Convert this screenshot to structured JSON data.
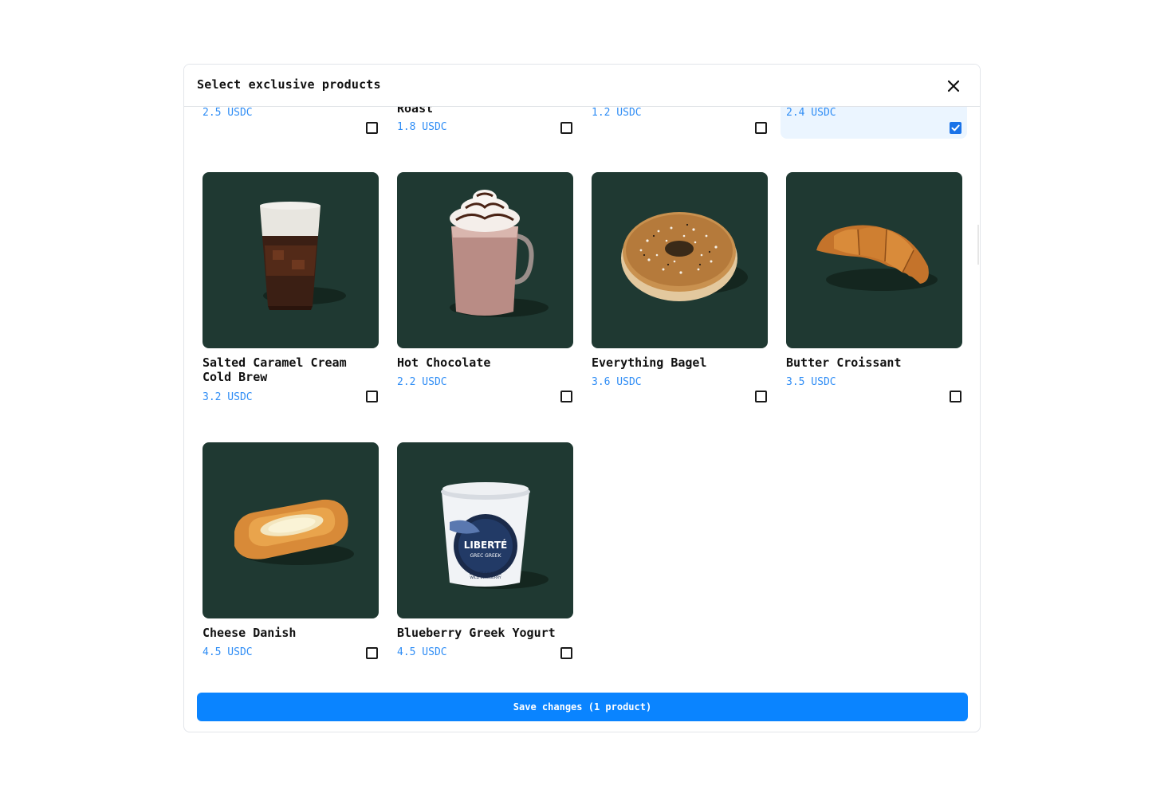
{
  "modal": {
    "title": "Select exclusive products",
    "close_icon": "close-icon",
    "save_label": "Save changes (1 product)"
  },
  "top_row": [
    {
      "name": "",
      "price": "2.5 USDC",
      "checked": false
    },
    {
      "name": "Roast",
      "price": "1.8 USDC",
      "checked": false
    },
    {
      "name": "",
      "price": "1.2 USDC",
      "checked": false
    },
    {
      "name": "",
      "price": "2.4 USDC",
      "checked": true
    }
  ],
  "products": [
    {
      "name": "Salted Caramel Cream Cold Brew",
      "price": "3.2 USDC",
      "checked": false,
      "image": "cold-brew-image"
    },
    {
      "name": "Hot Chocolate",
      "price": "2.2 USDC",
      "checked": false,
      "image": "hot-chocolate-image"
    },
    {
      "name": "Everything Bagel",
      "price": "3.6 USDC",
      "checked": false,
      "image": "bagel-image"
    },
    {
      "name": "Butter Croissant",
      "price": "3.5 USDC",
      "checked": false,
      "image": "croissant-image"
    },
    {
      "name": "Cheese Danish",
      "price": "4.5 USDC",
      "checked": false,
      "image": "danish-image"
    },
    {
      "name": "Blueberry Greek Yogurt",
      "price": "4.5 USDC",
      "checked": false,
      "image": "yogurt-image",
      "label_lines": [
        "LIBERTÉ",
        "GREC GREEK",
        "BLEUET SAUVAGE",
        "WILD BLUEBERRY"
      ]
    }
  ],
  "colors": {
    "image_bg": "#1f3932",
    "price": "#2f8df5",
    "accent": "#0a84ff",
    "selected_bg": "#ebf5ff"
  }
}
